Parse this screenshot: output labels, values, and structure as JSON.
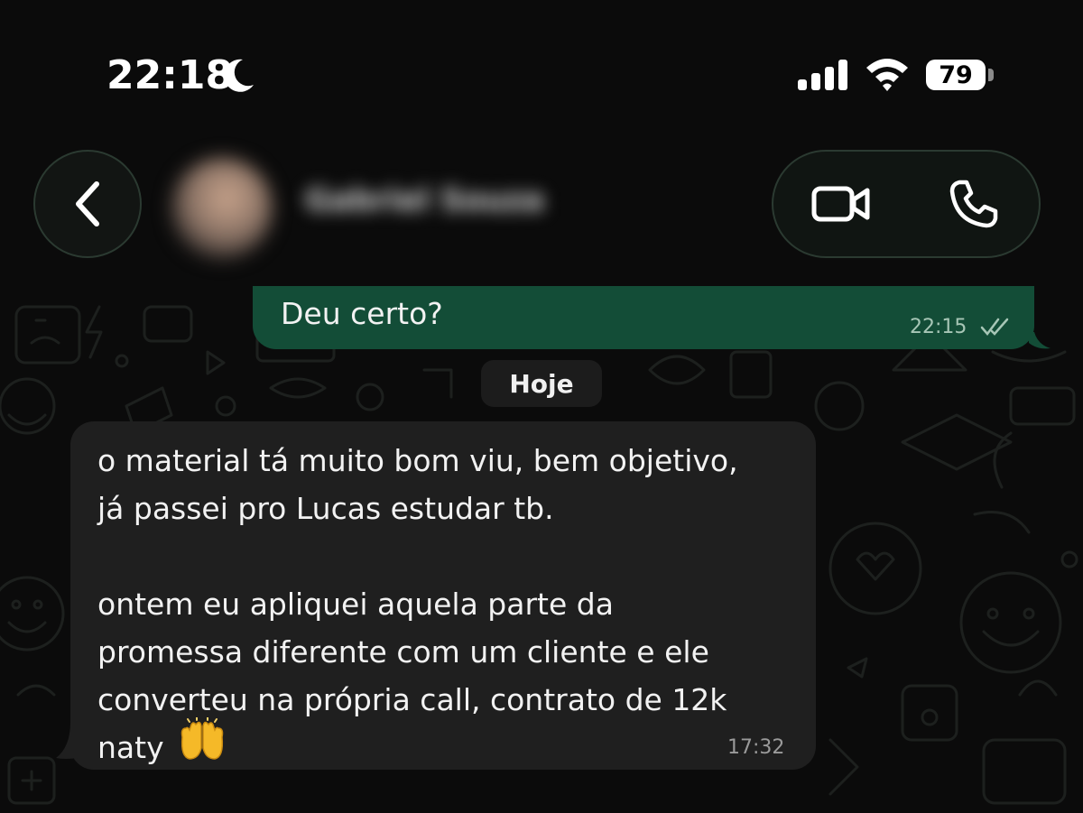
{
  "status_bar": {
    "time": "22:18",
    "battery": "79",
    "icons": [
      "moon-icon",
      "signal-icon",
      "wifi-icon",
      "battery-icon"
    ]
  },
  "header": {
    "contact_name": "Gabriel Souza",
    "icons": [
      "chevron-left-icon",
      "video-camera-icon",
      "phone-icon"
    ]
  },
  "messages": [
    {
      "direction": "outgoing",
      "text": "Deu certo?",
      "time": "22:15",
      "status_icon": "double-check-icon"
    },
    {
      "direction": "incoming",
      "text": "o material tá  muito bom viu, bem objetivo,\njá passei pro Lucas estudar tb.\n\nontem eu apliquei aquela parte da\npromessa diferente com um cliente e ele\nconverteu na própria call, contrato de 12k\nnaty",
      "emoji_icon": "raised-hands-icon",
      "time": "17:32"
    }
  ],
  "date_separator": "Hoje",
  "colors": {
    "background": "#0b0b0b",
    "outgoing_bubble": "#134d37",
    "incoming_bubble": "#1f1f1f",
    "button_border": "#2b3a31"
  }
}
